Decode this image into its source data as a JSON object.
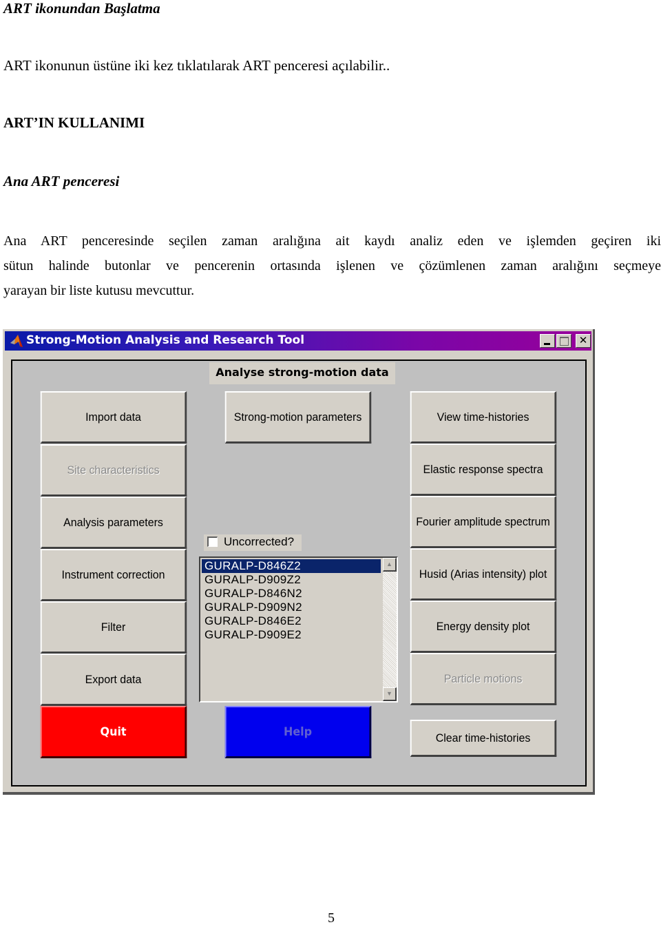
{
  "document": {
    "heading1": "ART ikonundan Başlatma",
    "paragraph1": "ART ikonunun üstüne iki kez tıklatılarak ART penceresi açılabilir..",
    "heading2": "ART’IN KULLANIMI",
    "heading3": "Ana ART penceresi",
    "paragraph2_lines": [
      "Ana ART penceresinde seçilen zaman aralığına ait kaydı analiz eden ve işlemden geçiren iki",
      "sütun halinde butonlar ve pencerenin ortasında işlenen ve çözümlenen zaman aralığını seçmeye",
      "yarayan bir liste kutusu mevcuttur."
    ],
    "page_number": "5"
  },
  "window": {
    "title": "Strong-Motion Analysis and Research Tool",
    "app_icon": "matlab-icon",
    "controls": {
      "minimize": "minimize-icon",
      "maximize": "maximize-icon",
      "close": "✕"
    },
    "panel_title": "Analyse strong-motion data",
    "left_buttons": [
      {
        "label": "Import data",
        "enabled": true
      },
      {
        "label": "Site characteristics",
        "enabled": false
      },
      {
        "label": "Analysis parameters",
        "enabled": true
      },
      {
        "label": "Instrument correction",
        "enabled": true
      },
      {
        "label": "Filter",
        "enabled": true
      },
      {
        "label": "Export data",
        "enabled": true
      }
    ],
    "middle_button": {
      "label": "Strong-motion parameters",
      "enabled": true
    },
    "right_buttons": [
      {
        "label": "View time-histories",
        "enabled": true
      },
      {
        "label": "Elastic response spectra",
        "enabled": true
      },
      {
        "label": "Fourier amplitude spectrum",
        "enabled": true
      },
      {
        "label": "Husid (Arias intensity) plot",
        "enabled": true
      },
      {
        "label": "Energy density plot",
        "enabled": true
      },
      {
        "label": "Particle motions",
        "enabled": false
      }
    ],
    "clear_button": {
      "label": "Clear time-histories"
    },
    "quit_button": {
      "label": "Quit",
      "color": "#ff0000"
    },
    "help_button": {
      "label": "Help",
      "color": "#0000ee",
      "enabled": false
    },
    "uncorrected_checkbox": {
      "label": "Uncorrected?",
      "checked": false
    },
    "listbox": {
      "selected_index": 0,
      "items": [
        "GURALP-D846Z2",
        "GURALP-D909Z2",
        "GURALP-D846N2",
        "GURALP-D909N2",
        "GURALP-D846E2",
        "GURALP-D909E2"
      ],
      "selection_color": "#0a246a"
    }
  }
}
